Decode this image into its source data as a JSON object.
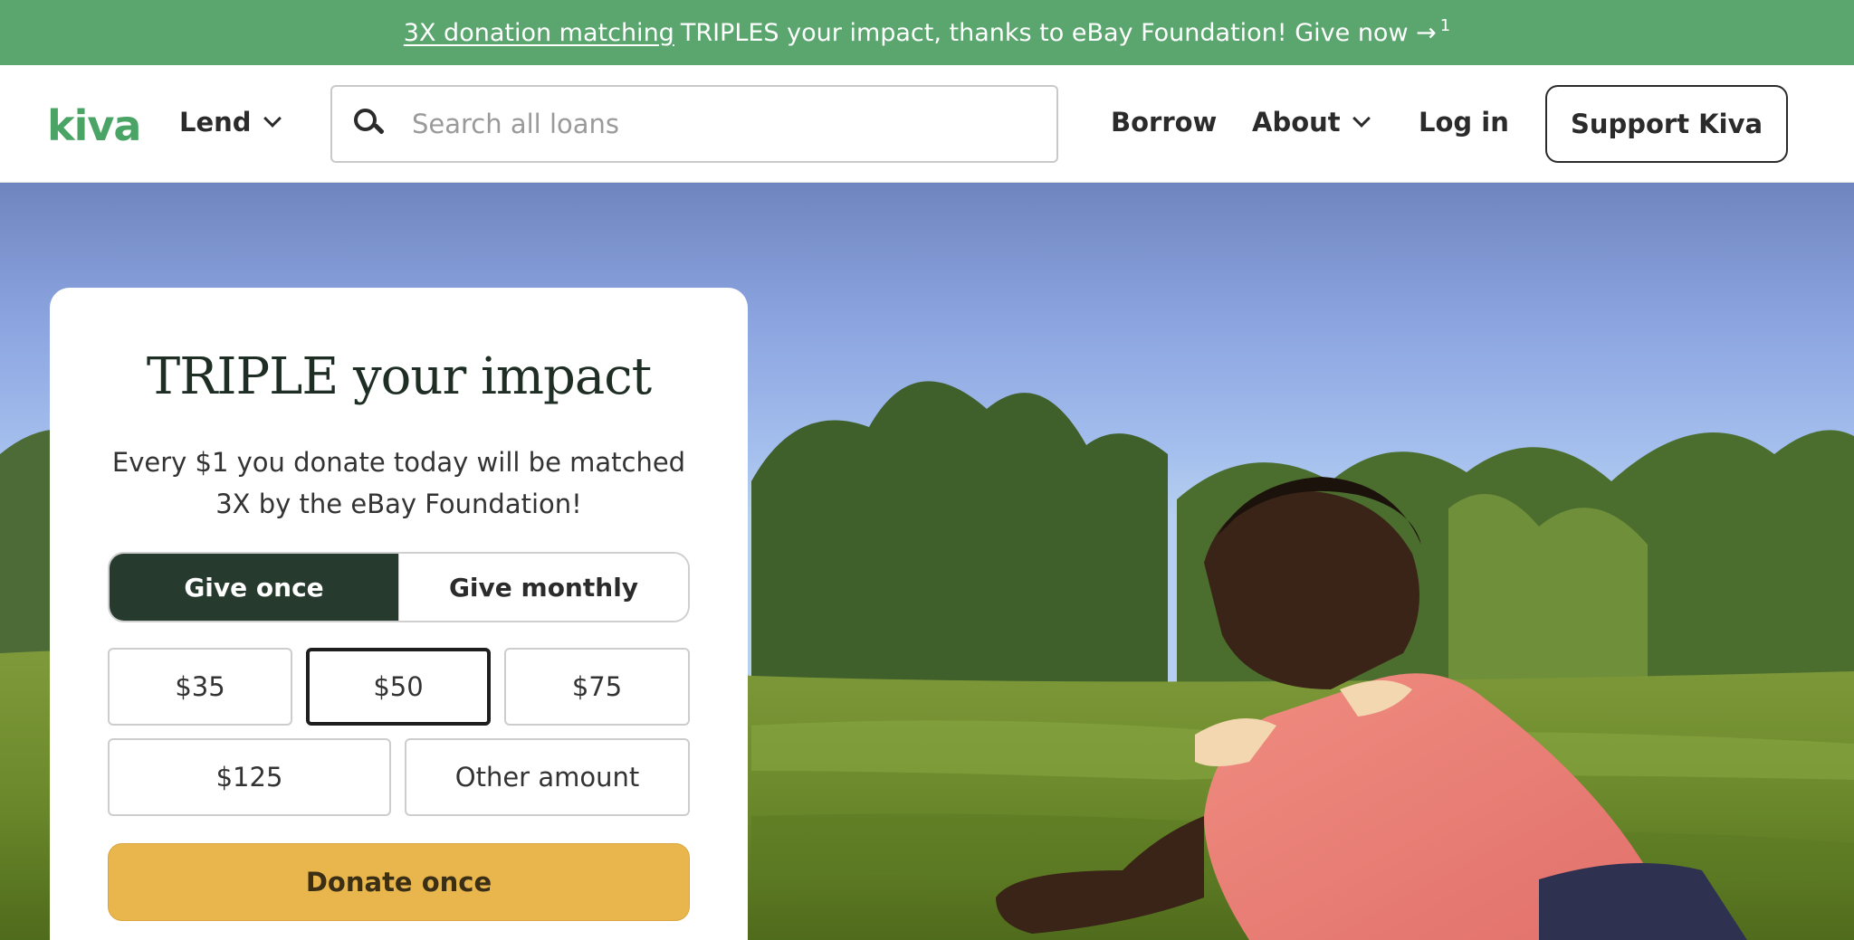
{
  "promo": {
    "link_text": "3X donation matching",
    "text": "TRIPLES your impact, thanks to eBay Foundation! Give now →",
    "footnote": "1"
  },
  "header": {
    "logo": "kiva",
    "lend_label": "Lend",
    "search_placeholder": "Search all loans",
    "borrow_label": "Borrow",
    "about_label": "About",
    "login_label": "Log in",
    "support_label": "Support Kiva"
  },
  "card": {
    "title": "TRIPLE your impact",
    "description": "Every $1 you donate today will be matched 3X by the eBay Foundation!",
    "toggle": {
      "once_label": "Give once",
      "monthly_label": "Give monthly",
      "selected": "once"
    },
    "amounts": [
      "$35",
      "$50",
      "$75",
      "$125",
      "Other amount"
    ],
    "selected_amount": "$50",
    "donate_label": "Donate once"
  },
  "colors": {
    "promo_bg": "#5aa66e",
    "brand_green": "#4aa466",
    "toggle_active": "#263a2e",
    "donate_button": "#e8b64c"
  }
}
